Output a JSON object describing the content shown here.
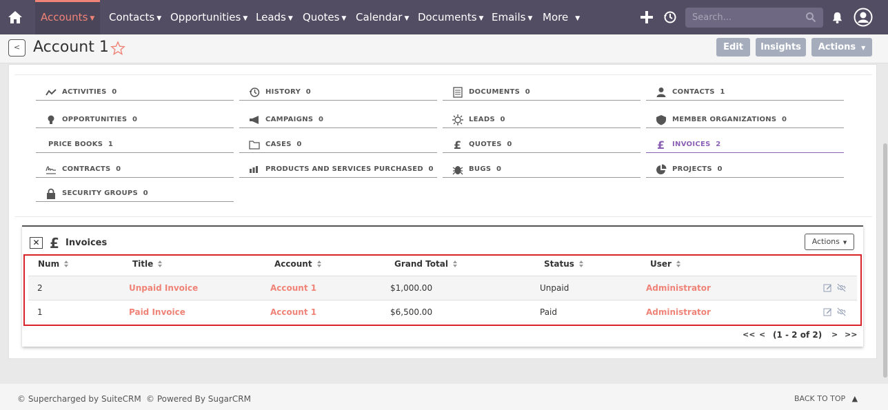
{
  "nav": {
    "items": [
      "Accounts",
      "Contacts",
      "Opportunities",
      "Leads",
      "Quotes",
      "Calendar",
      "Documents",
      "Emails",
      "More"
    ],
    "search_placeholder": "Search..."
  },
  "header": {
    "title": "Account 1",
    "edit": "Edit",
    "insights": "Insights",
    "actions": "Actions"
  },
  "subpanels": [
    {
      "label": "ACTIVITIES",
      "count": "0",
      "icon": "activity-icon"
    },
    {
      "label": "HISTORY",
      "count": "0",
      "icon": "history-icon"
    },
    {
      "label": "DOCUMENTS",
      "count": "0",
      "icon": "document-icon"
    },
    {
      "label": "CONTACTS",
      "count": "1",
      "icon": "person-icon"
    },
    {
      "label": "OPPORTUNITIES",
      "count": "0",
      "icon": "lightbulb-icon"
    },
    {
      "label": "CAMPAIGNS",
      "count": "0",
      "icon": "megaphone-icon"
    },
    {
      "label": "LEADS",
      "count": "0",
      "icon": "sun-icon"
    },
    {
      "label": "MEMBER ORGANIZATIONS",
      "count": "0",
      "icon": "shield-icon"
    },
    {
      "label": "PRICE BOOKS",
      "count": "1",
      "icon": ""
    },
    {
      "label": "CASES",
      "count": "0",
      "icon": "folder-icon"
    },
    {
      "label": "QUOTES",
      "count": "0",
      "icon": "pound-icon"
    },
    {
      "label": "INVOICES",
      "count": "2",
      "icon": "pound-icon"
    },
    {
      "label": "CONTRACTS",
      "count": "0",
      "icon": "signature-icon"
    },
    {
      "label": "PRODUCTS AND SERVICES PURCHASED",
      "count": "0",
      "icon": "bar-chart-icon"
    },
    {
      "label": "BUGS",
      "count": "0",
      "icon": "bug-icon"
    },
    {
      "label": "PROJECTS",
      "count": "0",
      "icon": "pie-chart-icon"
    },
    {
      "label": "SECURITY GROUPS",
      "count": "0",
      "icon": "lock-icon"
    }
  ],
  "invoices": {
    "title": "Invoices",
    "actions": "Actions",
    "columns": [
      "Num",
      "Title",
      "Account",
      "Grand Total",
      "Status",
      "User"
    ],
    "rows": [
      {
        "num": "2",
        "title": "Unpaid Invoice",
        "account": "Account 1",
        "total": "$1,000.00",
        "status": "Unpaid",
        "user": "Administrator"
      },
      {
        "num": "1",
        "title": "Paid Invoice",
        "account": "Account 1",
        "total": "$6,500.00",
        "status": "Paid",
        "user": "Administrator"
      }
    ],
    "pager": {
      "first": "<<",
      "prev": "<",
      "range": "(1 - 2 of 2)",
      "next": ">",
      "last": ">>"
    }
  },
  "footer": {
    "supercharged": "© Supercharged by SuiteCRM",
    "powered": "© Powered By SugarCRM",
    "back_to_top": "BACK TO TOP"
  },
  "colors": {
    "nav_bg": "#534d64",
    "accent": "#f08377",
    "active_subpanel": "#8b5fb5",
    "highlight_border": "#d9232b"
  }
}
